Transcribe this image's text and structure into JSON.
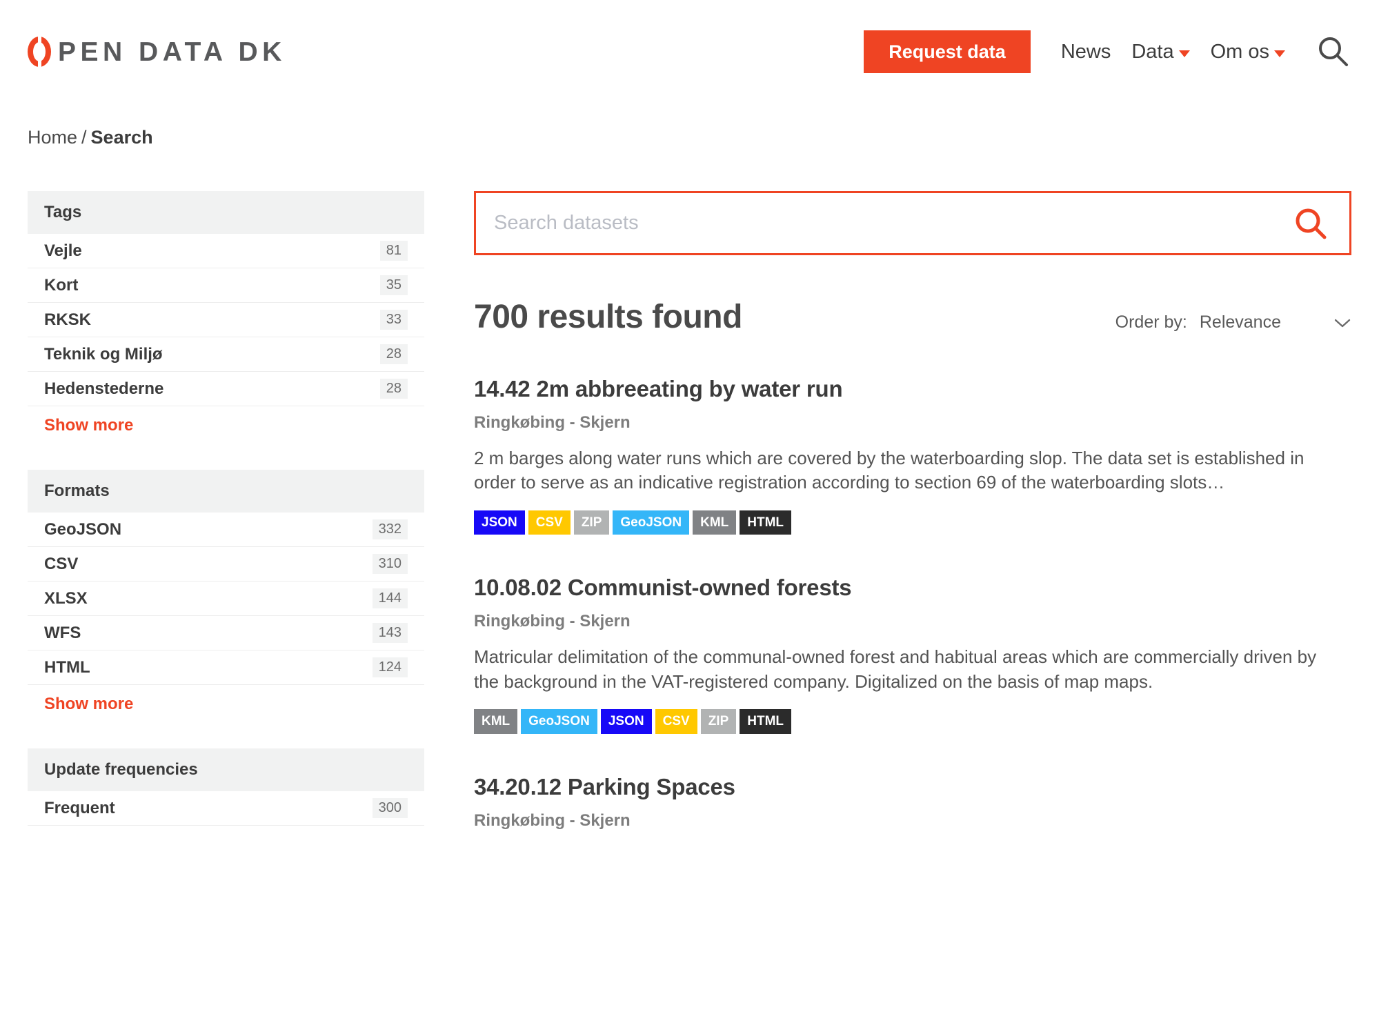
{
  "header": {
    "logo": {
      "mark": "open-data-ring-icon",
      "text": "PEN DATA DK"
    },
    "request_button": "Request data",
    "nav": [
      {
        "label": "News",
        "has_caret": false
      },
      {
        "label": "Data",
        "has_caret": true
      },
      {
        "label": "Om os",
        "has_caret": true
      }
    ],
    "search_icon": "search-icon"
  },
  "breadcrumb": {
    "home": "Home",
    "separator": "/",
    "current": "Search"
  },
  "sidebar": {
    "facets": [
      {
        "title": "Tags",
        "rows": [
          {
            "label": "Vejle",
            "count": "81"
          },
          {
            "label": "Kort",
            "count": "35"
          },
          {
            "label": "RKSK",
            "count": "33"
          },
          {
            "label": "Teknik og Miljø",
            "count": "28"
          },
          {
            "label": "Hedenstederne",
            "count": "28"
          }
        ],
        "show_more": "Show more"
      },
      {
        "title": "Formats",
        "rows": [
          {
            "label": "GeoJSON",
            "count": "332"
          },
          {
            "label": "CSV",
            "count": "310"
          },
          {
            "label": "XLSX",
            "count": "144"
          },
          {
            "label": "WFS",
            "count": "143"
          },
          {
            "label": "HTML",
            "count": "124"
          }
        ],
        "show_more": "Show more"
      },
      {
        "title": "Update frequencies",
        "rows": [
          {
            "label": "Frequent",
            "count": "300"
          }
        ],
        "show_more": ""
      }
    ]
  },
  "search": {
    "placeholder": "Search datasets",
    "value": "",
    "submit_icon": "search-icon"
  },
  "results": {
    "count_text": "700 results found",
    "order_by_label": "Order by:",
    "order_by_value": "Relevance",
    "chevron_icon": "chevron-down-icon",
    "items": [
      {
        "title": "14.42 2m abbreeating by water run",
        "org": "Ringkøbing - Skjern",
        "description": "2 m barges along water runs which are covered by the waterboarding slop. The data set is established in order to serve as an indicative registration according to section 69 of the waterboarding slots…",
        "formats": [
          "JSON",
          "CSV",
          "ZIP",
          "GeoJSON",
          "KML",
          "HTML"
        ]
      },
      {
        "title": "10.08.02 Communist-owned forests",
        "org": "Ringkøbing - Skjern",
        "description": "Matricular delimitation of the communal-owned forest and habitual areas which are commercially driven by the background in the VAT-registered company. Digitalized on the basis of map maps.",
        "formats": [
          "KML",
          "GeoJSON",
          "JSON",
          "CSV",
          "ZIP",
          "HTML"
        ]
      },
      {
        "title": "34.20.12 Parking Spaces",
        "org": "Ringkøbing - Skjern",
        "description": "",
        "formats": []
      }
    ]
  },
  "colors": {
    "accent": "#EF4423",
    "text_dark": "#3c3c3c",
    "facet_header_bg": "#F1F2F2",
    "badge_json": "#1709F7",
    "badge_csv": "#FFC800",
    "badge_zip": "#B1B3B3",
    "badge_geojson": "#34B6F8",
    "badge_kml": "#808285",
    "badge_html": "#2B2B2B",
    "badge_xlsx": "#1D6F42",
    "badge_wfs": "#6A4E9C"
  }
}
